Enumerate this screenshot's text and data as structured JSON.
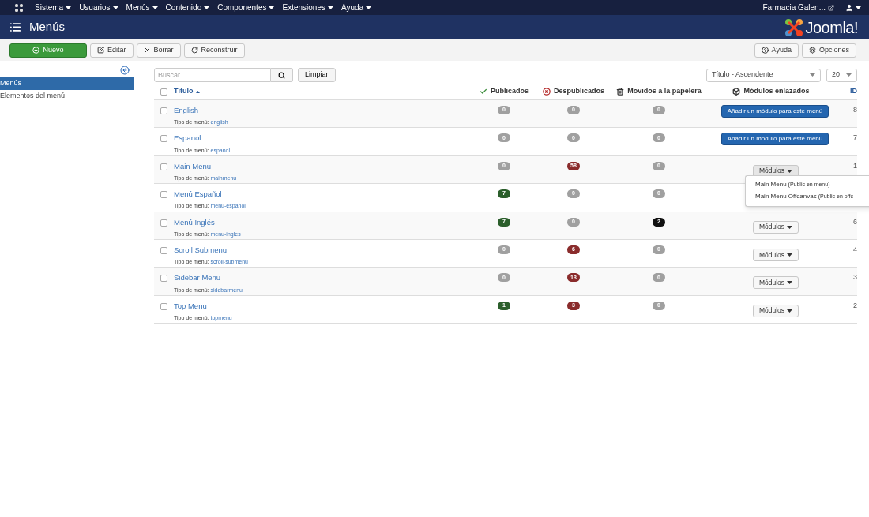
{
  "top_menu": {
    "items": [
      "Sistema",
      "Usuarios",
      "Menús",
      "Contenido",
      "Componentes",
      "Extensiones",
      "Ayuda"
    ],
    "site": "Farmacia Galen..."
  },
  "header": {
    "title": "Menús",
    "logo": "Joomla!"
  },
  "toolbar": {
    "left": [
      {
        "label": "Nuevo",
        "kind": "new"
      },
      {
        "label": "Editar",
        "kind": "edit"
      },
      {
        "label": "Borrar",
        "kind": "delete"
      },
      {
        "label": "Reconstruir",
        "kind": "rebuild"
      }
    ],
    "right": [
      {
        "label": "Ayuda",
        "kind": "help"
      },
      {
        "label": "Opciones",
        "kind": "options"
      }
    ]
  },
  "sidebar": {
    "items": [
      {
        "label": "Menús",
        "selected": true
      },
      {
        "label": "Elementos del menú",
        "selected": false
      }
    ]
  },
  "filters": {
    "search": {
      "placeholder": "Buscar"
    },
    "clear": "Limpiar",
    "sort": "Título - Ascendente",
    "limit": "20"
  },
  "table": {
    "select_all": {
      "checked": false
    },
    "columns": [
      {
        "label": "Título",
        "kind": "title"
      },
      {
        "label": "Publicados",
        "kind": "published"
      },
      {
        "label": "Despublicados",
        "kind": "unpublished"
      },
      {
        "label": "Movidos a la papelera",
        "kind": "trashed"
      },
      {
        "label": "Módulos enlazados",
        "kind": "modules"
      },
      {
        "label": "ID",
        "kind": "id"
      }
    ],
    "rows": [
      {
        "checked": false,
        "title": "English",
        "type_label": "Tipo de menú:",
        "alias": "english",
        "published": {
          "count": "0",
          "active": false
        },
        "unpublished": {
          "count": "0",
          "active": false
        },
        "trashed": {
          "count": "0",
          "active": false
        },
        "modules": {
          "kind": "add",
          "label": "Añadir un módulo para este menú"
        },
        "id": "8"
      },
      {
        "checked": false,
        "title": "Espanol",
        "type_label": "Tipo de menú:",
        "alias": "espanol",
        "published": {
          "count": "0",
          "active": false
        },
        "unpublished": {
          "count": "0",
          "active": false
        },
        "trashed": {
          "count": "0",
          "active": false
        },
        "modules": {
          "kind": "add",
          "label": "Añadir un módulo para este menú"
        },
        "id": "7"
      },
      {
        "checked": false,
        "title": "Main Menu",
        "type_label": "Tipo de menú:",
        "alias": "mainmenu",
        "published": {
          "count": "0",
          "active": false
        },
        "unpublished": {
          "count": "58",
          "active": true
        },
        "trashed": {
          "count": "0",
          "active": false
        },
        "modules": {
          "kind": "menu",
          "label": "Módulos",
          "expanded": true,
          "items": [
            {
              "title": "Main Menu",
              "note": "(Public en menu)"
            },
            {
              "title": "Main Menu Offcanvas",
              "note": "(Public en offc"
            }
          ]
        },
        "id": "1"
      },
      {
        "checked": false,
        "title": "Menú Español",
        "type_label": "Tipo de menú:",
        "alias": "menu-espanol",
        "published": {
          "count": "7",
          "active": true
        },
        "unpublished": {
          "count": "0",
          "active": false
        },
        "trashed": {
          "count": "0",
          "active": false
        }
      },
      {
        "checked": false,
        "title": "Menú Inglés",
        "type_label": "Tipo de menú:",
        "alias": "menu-ingles",
        "published": {
          "count": "7",
          "active": true
        },
        "unpublished": {
          "count": "0",
          "active": false
        },
        "trashed": {
          "count": "2",
          "active": true
        },
        "modules": {
          "kind": "menu",
          "label": "Módulos",
          "expanded": false
        },
        "id": "6"
      },
      {
        "checked": false,
        "title": "Scroll Submenu",
        "type_label": "Tipo de menú:",
        "alias": "scroll-submenu",
        "published": {
          "count": "0",
          "active": false
        },
        "unpublished": {
          "count": "6",
          "active": true
        },
        "trashed": {
          "count": "0",
          "active": false
        },
        "modules": {
          "kind": "menu",
          "label": "Módulos",
          "expanded": false
        },
        "id": "4"
      },
      {
        "checked": false,
        "title": "Sidebar Menu",
        "type_label": "Tipo de menú:",
        "alias": "sidebarmenu",
        "published": {
          "count": "0",
          "active": false
        },
        "unpublished": {
          "count": "13",
          "active": true
        },
        "trashed": {
          "count": "0",
          "active": false
        },
        "modules": {
          "kind": "menu",
          "label": "Módulos",
          "expanded": false
        },
        "id": "3"
      },
      {
        "checked": false,
        "title": "Top Menu",
        "type_label": "Tipo de menú:",
        "alias": "topmenu",
        "published": {
          "count": "1",
          "active": true
        },
        "unpublished": {
          "count": "3",
          "active": true
        },
        "trashed": {
          "count": "0",
          "active": false
        },
        "modules": {
          "kind": "menu",
          "label": "Módulos",
          "expanded": false
        },
        "id": "2"
      }
    ]
  }
}
